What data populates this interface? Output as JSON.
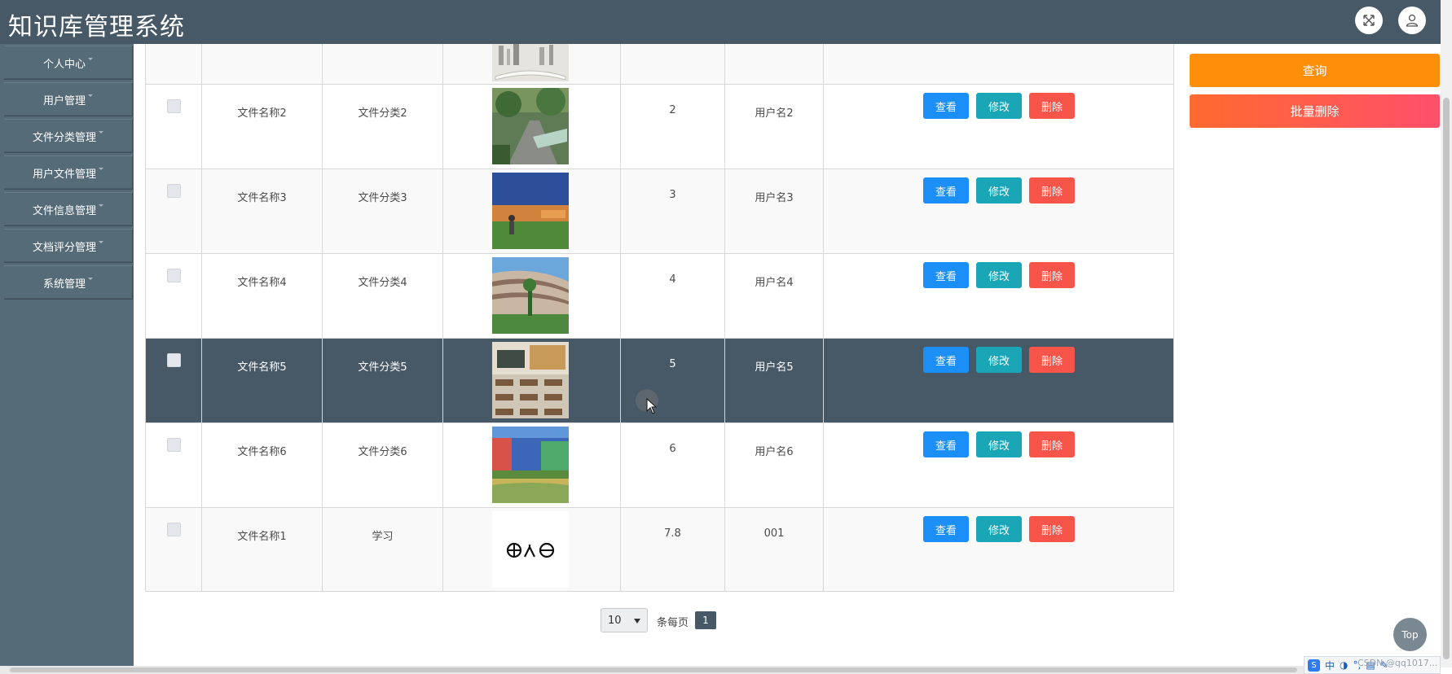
{
  "header": {
    "title": "知识库管理系统"
  },
  "sidebar": {
    "items": [
      {
        "label": "个人中心"
      },
      {
        "label": "用户管理"
      },
      {
        "label": "文件分类管理"
      },
      {
        "label": "用户文件管理"
      },
      {
        "label": "文件信息管理"
      },
      {
        "label": "文档评分管理"
      },
      {
        "label": "系统管理"
      }
    ]
  },
  "actions": {
    "search_label": "查询",
    "batch_delete_label": "批量删除"
  },
  "row_buttons": {
    "view": "查看",
    "edit": "修改",
    "delete": "删除"
  },
  "table": {
    "rows": [
      {
        "name": "文件名称2",
        "category": "文件分类2",
        "score": "2",
        "user": "用户名2",
        "image": "garden-path-photo"
      },
      {
        "name": "文件名称3",
        "category": "文件分类3",
        "score": "3",
        "user": "用户名3",
        "image": "sports-field-photo"
      },
      {
        "name": "文件名称4",
        "category": "文件分类4",
        "score": "4",
        "user": "用户名4",
        "image": "campus-building-photo"
      },
      {
        "name": "文件名称5",
        "category": "文件分类5",
        "score": "5",
        "user": "用户名5",
        "image": "classroom-photo",
        "highlighted": true
      },
      {
        "name": "文件名称6",
        "category": "文件分类6",
        "score": "6",
        "user": "用户名6",
        "image": "school-lake-photo"
      },
      {
        "name": "文件名称1",
        "category": "学习",
        "score": "7.8",
        "user": "001",
        "image": "symbol-image"
      }
    ]
  },
  "pagination": {
    "page_size": "10",
    "per_page_label": "条每页",
    "current_page": "1"
  },
  "top_button_label": "Top",
  "ime": {
    "label": "中"
  },
  "watermark": "CSDN @qq1017..."
}
